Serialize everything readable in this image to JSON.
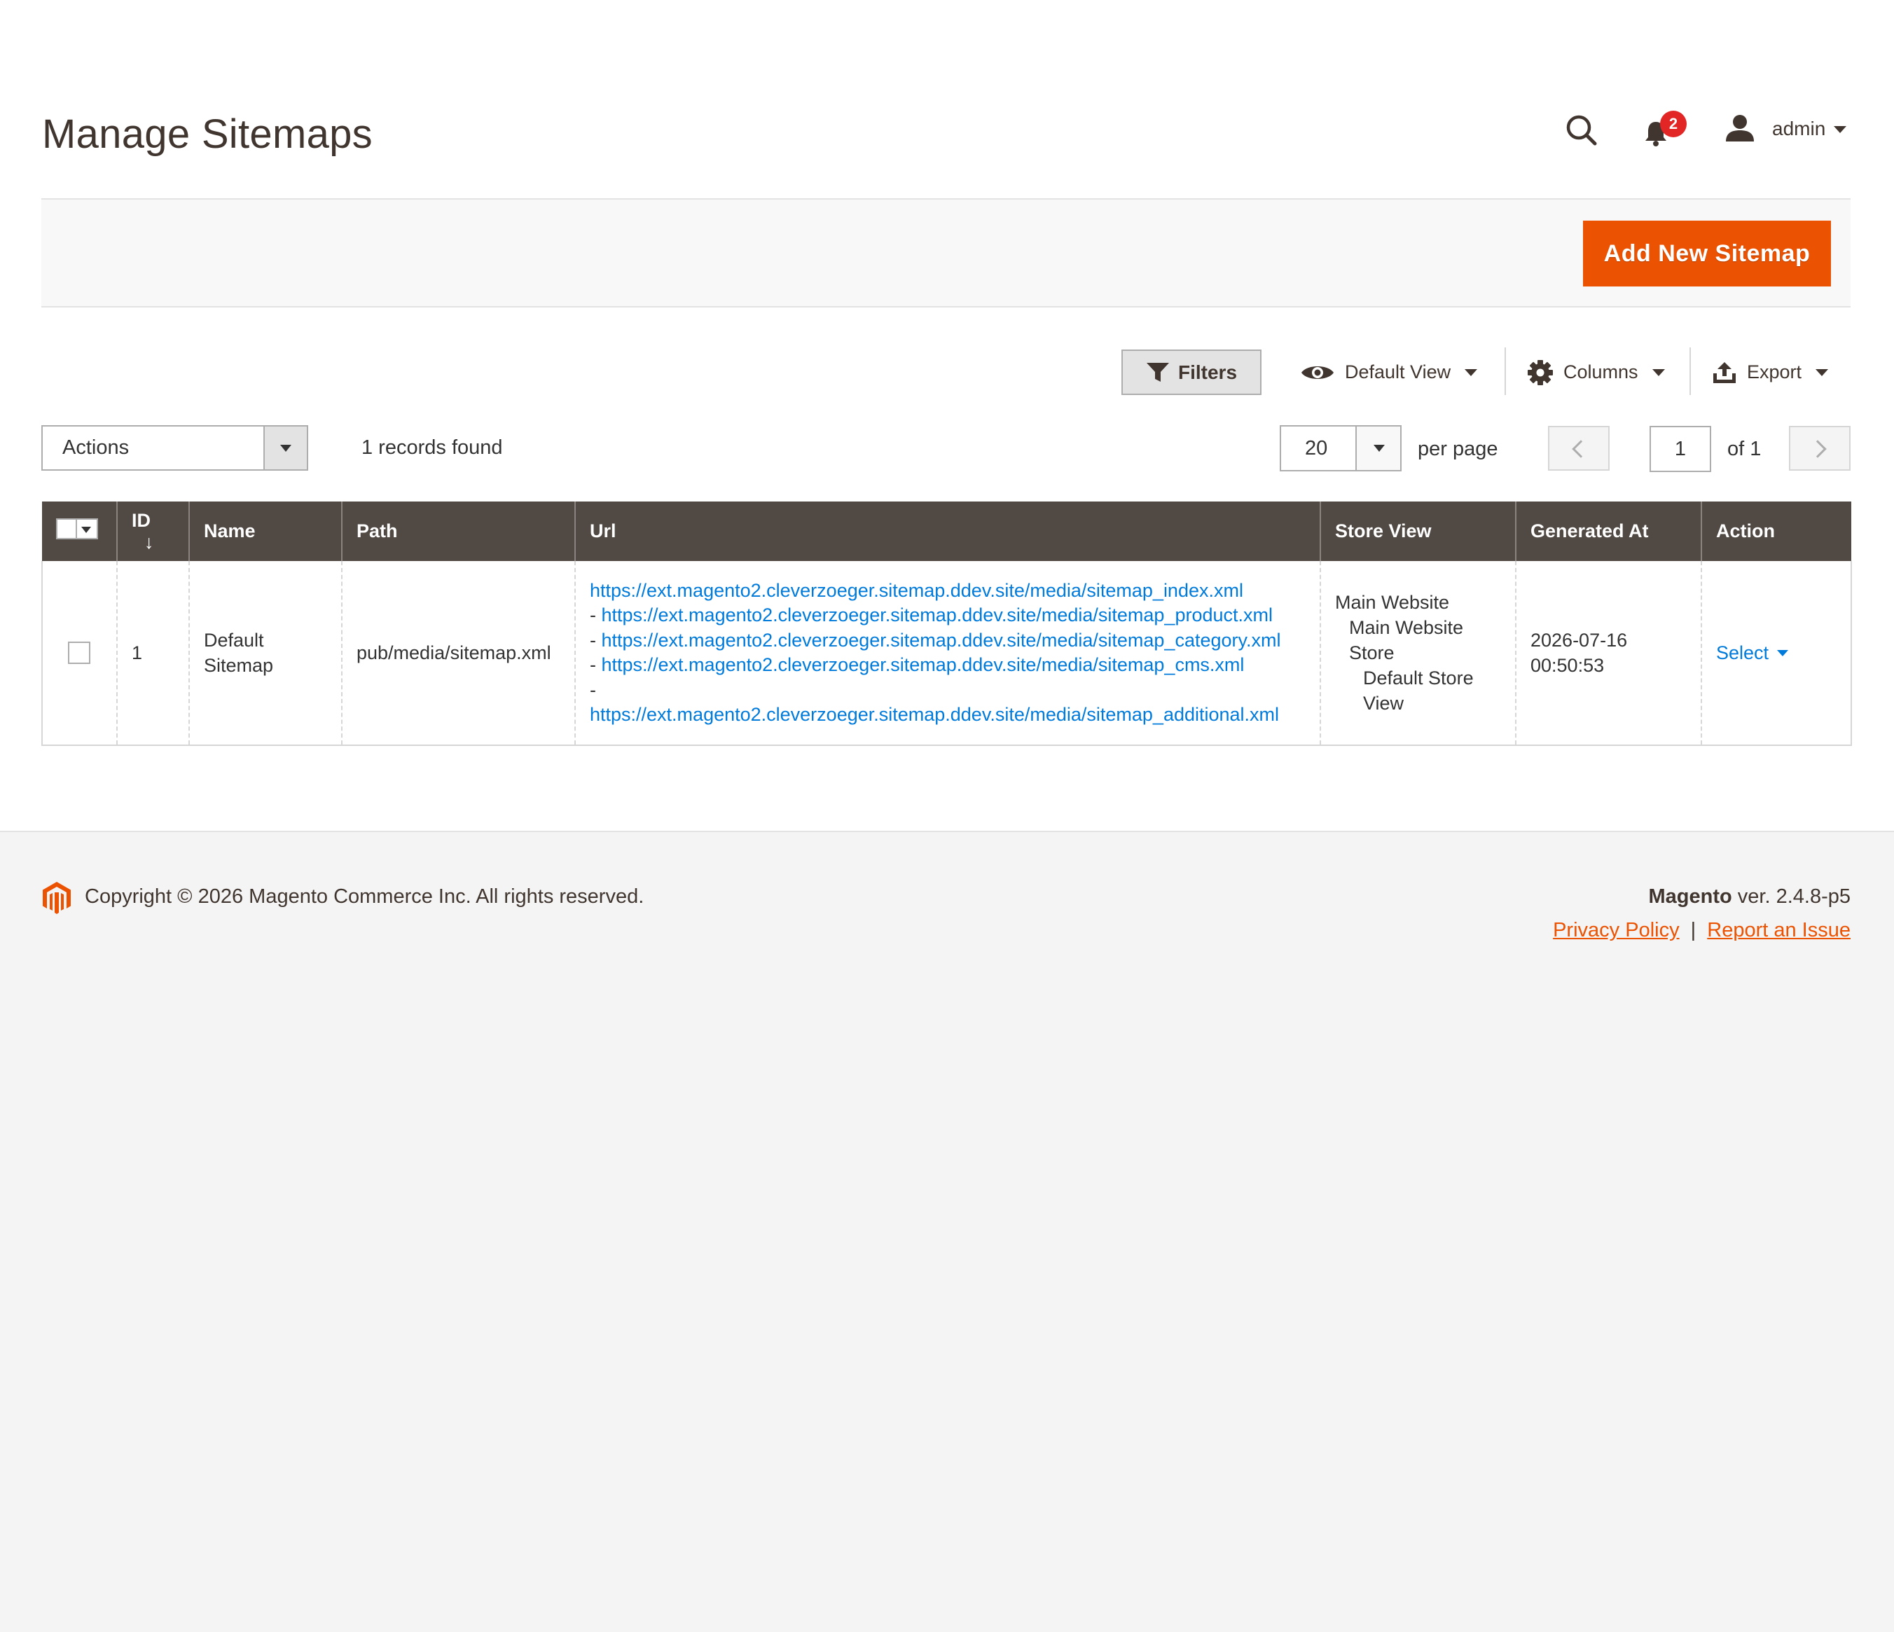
{
  "header": {
    "title": "Manage Sitemaps",
    "notifications_count": "2",
    "user_name": "admin"
  },
  "page_actions": {
    "add_label": "Add New Sitemap"
  },
  "toolbar": {
    "filters_label": "Filters",
    "view_label": "Default View",
    "columns_label": "Columns",
    "export_label": "Export"
  },
  "grid_controls": {
    "actions_label": "Actions",
    "records_found": "1 records found",
    "per_page_value": "20",
    "per_page_label": "per page",
    "current_page": "1",
    "page_total": "of 1"
  },
  "table": {
    "columns": [
      "ID",
      "Name",
      "Path",
      "Url",
      "Store View",
      "Generated At",
      "Action"
    ],
    "sort_indicator": "↓",
    "rows": [
      {
        "id": "1",
        "name": "Default Sitemap",
        "path": "pub/media/sitemap.xml",
        "urls": [
          "https://ext.magento2.cleverzoeger.sitemap.ddev.site/media/sitemap_index.xml",
          "https://ext.magento2.cleverzoeger.sitemap.ddev.site/media/sitemap_product.xml",
          "https://ext.magento2.cleverzoeger.sitemap.ddev.site/media/sitemap_category.xml",
          "https://ext.magento2.cleverzoeger.sitemap.ddev.site/media/sitemap_cms.xml",
          "https://ext.magento2.cleverzoeger.sitemap.ddev.site/media/sitemap_additional.xml"
        ],
        "url_prefix": "- ",
        "url_dash": "-",
        "store_view": {
          "website": "Main Website",
          "store": "Main Website Store",
          "view": "Default Store View"
        },
        "generated_at_date": "2026-07-16",
        "generated_at_time": "00:50:53",
        "action_label": "Select"
      }
    ]
  },
  "footer": {
    "copyright": "Copyright © 2026 Magento Commerce Inc. All rights reserved.",
    "brand": "Magento",
    "version": " ver. 2.4.8-p5",
    "privacy_label": "Privacy Policy",
    "separator": "|",
    "report_label": "Report an Issue"
  },
  "colors": {
    "accent": "#eb5202",
    "header_bg": "#514943",
    "link": "#007bdb",
    "badge": "#e22626"
  }
}
